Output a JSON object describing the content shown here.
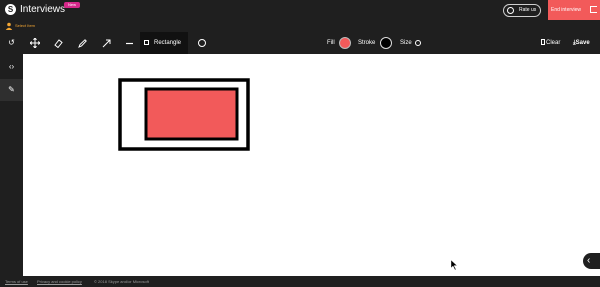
{
  "header": {
    "title": "Interviews",
    "badge": "New",
    "rate_label": "Rate us",
    "end_label": "End interview"
  },
  "select_item": {
    "label": "Select Item"
  },
  "toolbar": {
    "shape_label": "Rectangle",
    "fill_label": "Fill",
    "stroke_label": "Stroke",
    "size_label": "Size",
    "clear_label": "Clear",
    "save_label": "Save",
    "fill_color": "#f25a5a",
    "stroke_color": "#000000"
  },
  "canvas": {
    "outer_shape": {
      "fill": "#ffffff",
      "stroke": "#000000"
    },
    "inner_shape": {
      "fill": "#f25a5a",
      "stroke": "#000000"
    }
  },
  "footer": {
    "terms": "Terms of use",
    "privacy": "Privacy and cookie policy",
    "copyright": "© 2018 Skype and/or Microsoft"
  }
}
